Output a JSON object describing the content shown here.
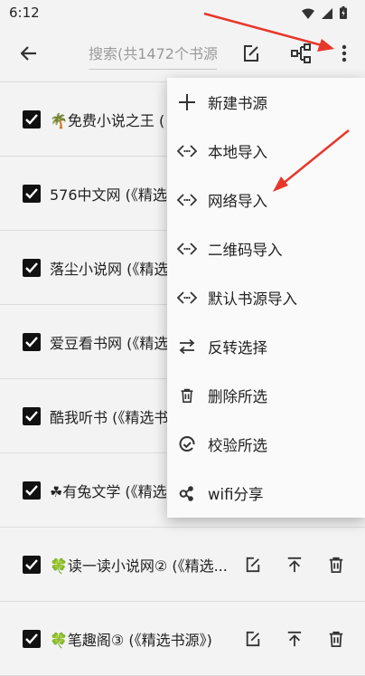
{
  "status_bar": {
    "time": "6:12"
  },
  "toolbar": {
    "search_placeholder": "搜索(共1472个书源)"
  },
  "sources": [
    {
      "name": "🌴免费小说之王 ("
    },
    {
      "name": "576中文网 (《精选"
    },
    {
      "name": "落尘小说网 (《精选"
    },
    {
      "name": "爱豆看书网 (《精选"
    },
    {
      "name": "酷我听书 (《精选书"
    },
    {
      "name": "☘有兔文学 (《精选"
    },
    {
      "name": "🍀读一读小说网② (《精选..."
    },
    {
      "name": "🍀笔趣阁③ (《精选书源》)"
    }
  ],
  "menu": {
    "items": [
      {
        "label": "新建书源",
        "icon": "plus-icon"
      },
      {
        "label": "本地导入",
        "icon": "code-icon"
      },
      {
        "label": "网络导入",
        "icon": "code-icon"
      },
      {
        "label": "二维码导入",
        "icon": "code-icon"
      },
      {
        "label": "默认书源导入",
        "icon": "code-icon"
      },
      {
        "label": "反转选择",
        "icon": "swap-icon"
      },
      {
        "label": "删除所选",
        "icon": "trash-icon"
      },
      {
        "label": "校验所选",
        "icon": "check-circle-icon"
      },
      {
        "label": "wifi分享",
        "icon": "share-icon"
      }
    ]
  },
  "annotation_color": "#e8362a"
}
